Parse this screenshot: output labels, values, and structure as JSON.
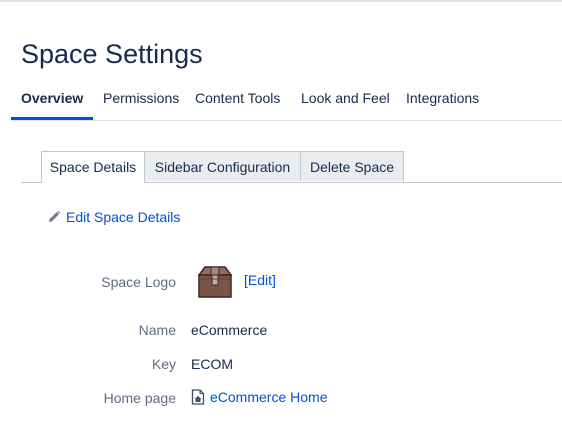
{
  "page_title": "Space Settings",
  "main_tabs": [
    {
      "label": "Overview",
      "active": true
    },
    {
      "label": "Permissions",
      "active": false
    },
    {
      "label": "Content Tools",
      "active": false
    },
    {
      "label": "Look and Feel",
      "active": false
    },
    {
      "label": "Integrations",
      "active": false
    }
  ],
  "sub_tabs": [
    {
      "label": "Space Details",
      "active": true
    },
    {
      "label": "Sidebar Configuration",
      "active": false
    },
    {
      "label": "Delete Space",
      "active": false
    }
  ],
  "edit_details": {
    "label": "Edit Space Details",
    "icon": "pencil-icon"
  },
  "details": {
    "logo_label": "Space Logo",
    "logo_edit": "[Edit]",
    "logo_icon": "box-icon",
    "name_label": "Name",
    "name_value": "eCommerce",
    "key_label": "Key",
    "key_value": "ECOM",
    "home_label": "Home page",
    "home_value": "eCommerce Home",
    "home_icon": "home-page-icon"
  },
  "colors": {
    "accent": "#0052cc",
    "text": "#172b4d",
    "label": "#5e6c84",
    "tab_inactive_bg": "#ebecf0"
  }
}
